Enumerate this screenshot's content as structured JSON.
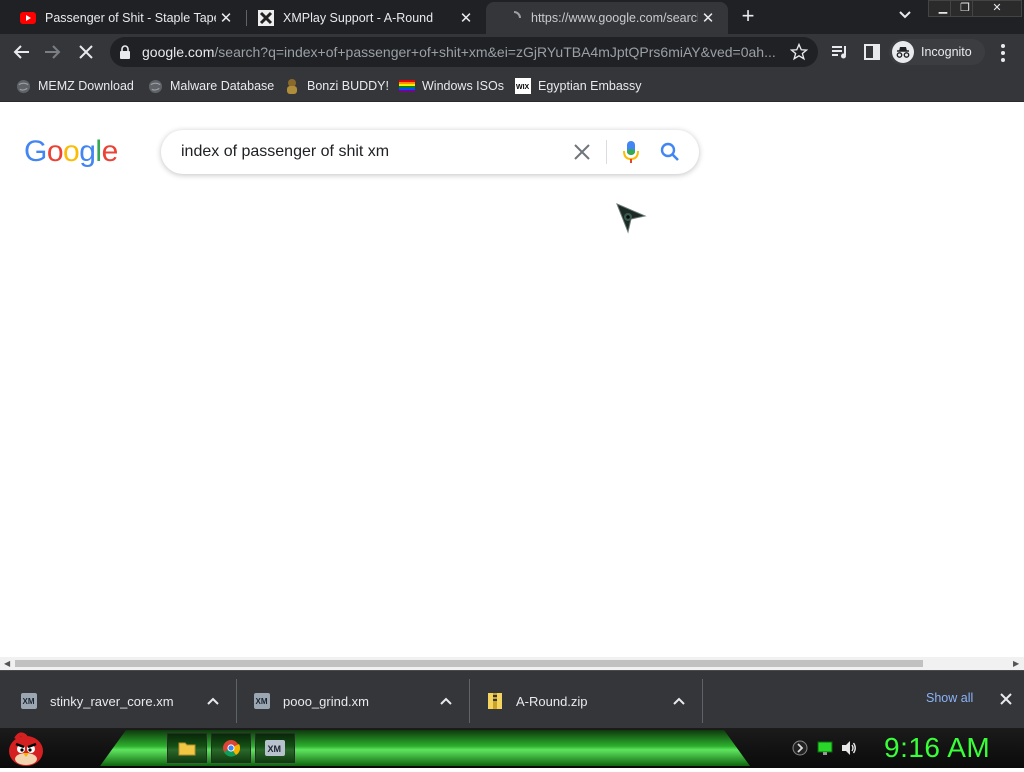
{
  "tabs": [
    {
      "title": "Passenger of Shit - Staple Tapewo",
      "favicon": "youtube-icon",
      "active": false
    },
    {
      "title": "XMPlay Support - A-Round",
      "favicon": "xmplay-icon",
      "active": false
    },
    {
      "title": "https://www.google.com/search?",
      "favicon": "loading-spinner-icon",
      "active": true
    }
  ],
  "toolbar": {
    "url_host": "google.com",
    "url_path": "/search?q=index+of+passenger+of+shit+xm&ei=zGjRYuTBA4mJptQPrs6miAY&ved=0ah...",
    "incognito_label": "Incognito"
  },
  "bookmarks": [
    {
      "label": "MEMZ Download",
      "icon": "globe-icon"
    },
    {
      "label": "Malware Database",
      "icon": "globe-icon"
    },
    {
      "label": "Bonzi BUDDY!",
      "icon": "bonzi-icon"
    },
    {
      "label": "Windows ISOs",
      "icon": "rainbow-flag-icon"
    },
    {
      "label": "Egyptian Embassy",
      "icon": "wix-icon"
    }
  ],
  "page": {
    "logo": "Google",
    "query": "index of passenger of shit xm"
  },
  "downloads": {
    "items": [
      {
        "name": "stinky_raver_core.xm",
        "icon": "xm-file-icon"
      },
      {
        "name": "pooo_grind.xm",
        "icon": "xm-file-icon"
      },
      {
        "name": "A-Round.zip",
        "icon": "zip-file-icon"
      }
    ],
    "show_all": "Show all"
  },
  "taskbar": {
    "clock": "9:16 AM"
  },
  "colors": {
    "tab_bg": "#202124",
    "toolbar_bg": "#35363a",
    "link_blue": "#8ab4f8",
    "clock_green": "#38ff38"
  }
}
